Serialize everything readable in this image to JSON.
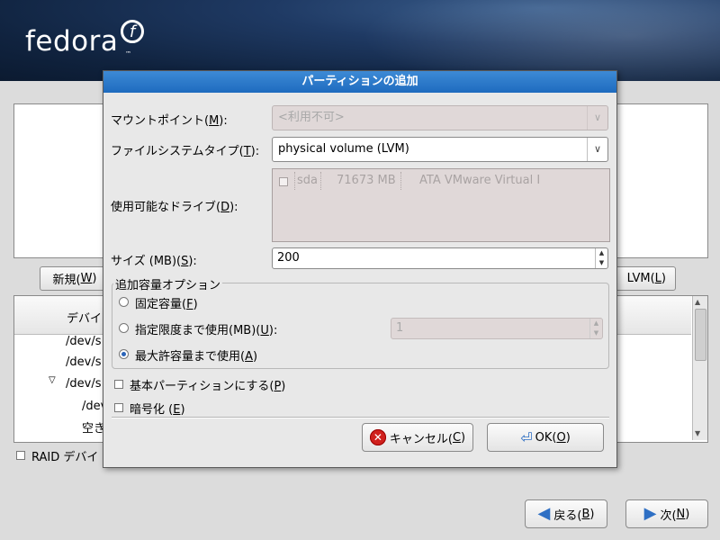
{
  "brand": {
    "logo_text": "fedora",
    "logo_mark": "f",
    "tm": "™"
  },
  "background": {
    "new_button": {
      "label": "新規(",
      "mnemonic": "W",
      "suffix": ")"
    },
    "lvm_button": {
      "label": "LVM(",
      "mnemonic": "L",
      "suffix": ")"
    },
    "tree_header": "デバイ",
    "tree_rows": [
      "/dev/s",
      "/dev/s",
      "/dev/s",
      "/dev",
      "空き"
    ],
    "raid_checkbox_label": "RAID デバイ",
    "back_button": {
      "label": "戻る(",
      "mnemonic": "B",
      "suffix": ")"
    },
    "next_button": {
      "label": "次(",
      "mnemonic": "N",
      "suffix": ")"
    }
  },
  "dialog": {
    "title": "パーティションの追加",
    "mount_point": {
      "label": "マウントポイント(",
      "mnemonic": "M",
      "suffix": "):",
      "value": "<利用不可>"
    },
    "fs_type": {
      "label": "ファイルシステムタイプ(",
      "mnemonic": "T",
      "suffix": "):",
      "value": "physical volume (LVM)"
    },
    "drives": {
      "label": "使用可能なドライブ(",
      "mnemonic": "D",
      "suffix": "):",
      "rows": [
        {
          "checked": false,
          "device": "sda",
          "size": "71673 MB",
          "model": "ATA VMware Virtual I"
        }
      ]
    },
    "size": {
      "label": "サイズ (MB)(",
      "mnemonic": "S",
      "suffix": "):",
      "value": "200"
    },
    "additional_size": {
      "legend": "追加容量オプション",
      "options": [
        {
          "label": "固定容量(",
          "mnemonic": "F",
          "suffix": ")",
          "selected": false
        },
        {
          "label": "指定限度まで使用(MB)(",
          "mnemonic": "U",
          "suffix": "):",
          "selected": false
        },
        {
          "label": "最大許容量まで使用(",
          "mnemonic": "A",
          "suffix": ")",
          "selected": true
        }
      ],
      "limit_value": "1"
    },
    "primary_checkbox": {
      "label": "基本パーティションにする(",
      "mnemonic": "P",
      "suffix": ")",
      "checked": false
    },
    "encrypt_checkbox": {
      "label": "暗号化 (",
      "mnemonic": "E",
      "suffix": ")",
      "checked": false
    },
    "cancel_button": {
      "label": "キャンセル(",
      "mnemonic": "C",
      "suffix": ")"
    },
    "ok_button": {
      "label": "OK(",
      "mnemonic": "O",
      "suffix": ")"
    }
  },
  "colors": {
    "title_bar": "#1e6bbf",
    "cancel_icon": "#d0201d",
    "arrow_icon": "#2e6fc4"
  }
}
